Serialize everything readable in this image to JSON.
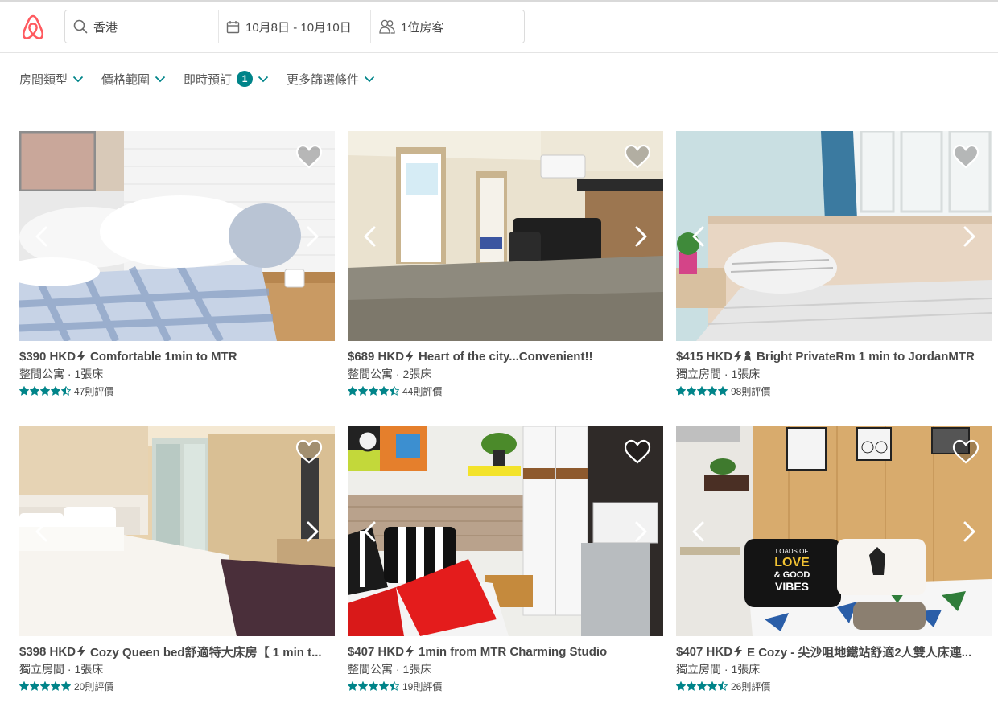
{
  "search": {
    "location": "香港",
    "dates": "10月8日 - 10月10日",
    "guests": "1位房客"
  },
  "filters": {
    "room_type": "房間類型",
    "price_range": "價格範圍",
    "instant_book": "即時預訂",
    "instant_book_count": "1",
    "more_filters": "更多篩選條件"
  },
  "colors": {
    "brand": "#FF5A5F",
    "accent": "#008489",
    "text": "#484848"
  },
  "listings": [
    {
      "price": "$390 HKD",
      "name": "Comfortable 1min to MTR",
      "type": "整間公寓",
      "beds": "1張床",
      "rating": 4.5,
      "reviews": "47則評價",
      "badges": [
        "bolt-icon"
      ]
    },
    {
      "price": "$689 HKD",
      "name": "Heart of the city...Convenient!!",
      "type": "整間公寓",
      "beds": "2張床",
      "rating": 4.5,
      "reviews": "44則評價",
      "badges": [
        "bolt-icon"
      ]
    },
    {
      "price": "$415 HKD",
      "name": "Bright PrivateRm 1 min to JordanMTR",
      "type": "獨立房間",
      "beds": "1張床",
      "rating": 5,
      "reviews": "98則評價",
      "badges": [
        "bolt-icon",
        "superhost-icon"
      ]
    },
    {
      "price": "$398 HKD",
      "name": "Cozy Queen bed舒適特大床房【 1 min t...",
      "type": "獨立房間",
      "beds": "1張床",
      "rating": 5,
      "reviews": "20則評價",
      "badges": [
        "bolt-icon"
      ]
    },
    {
      "price": "$407 HKD",
      "name": "1min from MTR Charming Studio",
      "type": "整間公寓",
      "beds": "1張床",
      "rating": 4.5,
      "reviews": "19則評價",
      "badges": [
        "bolt-icon"
      ]
    },
    {
      "price": "$407 HKD",
      "name": "E Cozy - 尖沙咀地鐵站舒適2人雙人床連...",
      "type": "獨立房間",
      "beds": "1張床",
      "rating": 4.5,
      "reviews": "26則評價",
      "badges": [
        "bolt-icon"
      ]
    }
  ],
  "photo_texts": {
    "pillow_line1": "LOADS OF",
    "pillow_line2": "LOVE",
    "pillow_line3": "& GOOD",
    "pillow_line4": "VIBES"
  }
}
